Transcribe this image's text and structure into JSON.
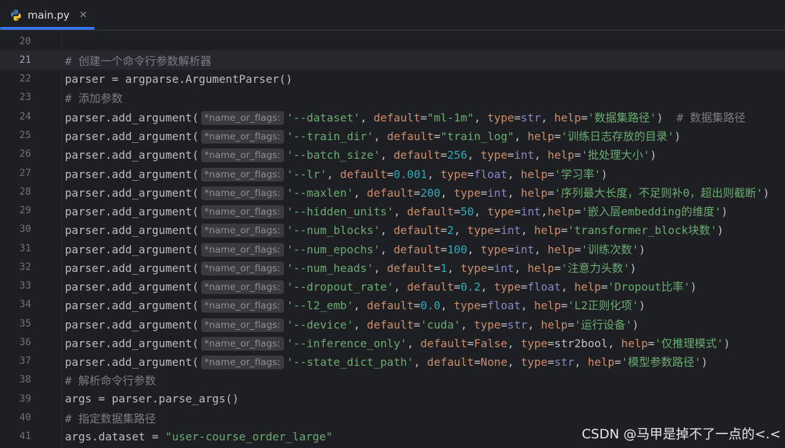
{
  "tab": {
    "filename": "main.py"
  },
  "current_line": 21,
  "lines": [
    {
      "n": "20",
      "segs": []
    },
    {
      "n": "21",
      "segs": [
        {
          "t": "# 创建一个命令行参数解析器",
          "c": "cmt"
        }
      ]
    },
    {
      "n": "22",
      "segs": [
        {
          "t": "parser = argparse.ArgumentParser()",
          "c": ""
        }
      ]
    },
    {
      "n": "23",
      "segs": [
        {
          "t": "# 添加参数",
          "c": "cmt"
        }
      ]
    },
    {
      "n": "24",
      "segs": [
        {
          "t": "parser.add_argument(",
          "c": ""
        },
        {
          "h": "*name_or_flags:"
        },
        {
          "t": "'--dataset'",
          "c": "str"
        },
        {
          "t": ", ",
          "c": ""
        },
        {
          "t": "default",
          "c": "kw"
        },
        {
          "t": "=",
          "c": ""
        },
        {
          "t": "\"ml-1m\"",
          "c": "str"
        },
        {
          "t": ", ",
          "c": ""
        },
        {
          "t": "type",
          "c": "kw"
        },
        {
          "t": "=",
          "c": ""
        },
        {
          "t": "str",
          "c": "builtin"
        },
        {
          "t": ", ",
          "c": ""
        },
        {
          "t": "help",
          "c": "kw"
        },
        {
          "t": "=",
          "c": ""
        },
        {
          "t": "'数据集路径'",
          "c": "str"
        },
        {
          "t": ")  ",
          "c": ""
        },
        {
          "t": "# 数据集路径",
          "c": "cmt"
        }
      ]
    },
    {
      "n": "25",
      "segs": [
        {
          "t": "parser.add_argument(",
          "c": ""
        },
        {
          "h": "*name_or_flags:"
        },
        {
          "t": "'--train_dir'",
          "c": "str"
        },
        {
          "t": ", ",
          "c": ""
        },
        {
          "t": "default",
          "c": "kw"
        },
        {
          "t": "=",
          "c": ""
        },
        {
          "t": "\"train_log\"",
          "c": "str"
        },
        {
          "t": ", ",
          "c": ""
        },
        {
          "t": "help",
          "c": "kw"
        },
        {
          "t": "=",
          "c": ""
        },
        {
          "t": "'训练日志存放的目录'",
          "c": "str"
        },
        {
          "t": ")",
          "c": ""
        }
      ]
    },
    {
      "n": "26",
      "segs": [
        {
          "t": "parser.add_argument(",
          "c": ""
        },
        {
          "h": "*name_or_flags:"
        },
        {
          "t": "'--batch_size'",
          "c": "str"
        },
        {
          "t": ", ",
          "c": ""
        },
        {
          "t": "default",
          "c": "kw"
        },
        {
          "t": "=",
          "c": ""
        },
        {
          "t": "256",
          "c": "num"
        },
        {
          "t": ", ",
          "c": ""
        },
        {
          "t": "type",
          "c": "kw"
        },
        {
          "t": "=",
          "c": ""
        },
        {
          "t": "int",
          "c": "builtin"
        },
        {
          "t": ", ",
          "c": ""
        },
        {
          "t": "help",
          "c": "kw"
        },
        {
          "t": "=",
          "c": ""
        },
        {
          "t": "'批处理大小'",
          "c": "str"
        },
        {
          "t": ")",
          "c": ""
        }
      ]
    },
    {
      "n": "27",
      "segs": [
        {
          "t": "parser.add_argument(",
          "c": ""
        },
        {
          "h": "*name_or_flags:"
        },
        {
          "t": "'--lr'",
          "c": "str"
        },
        {
          "t": ", ",
          "c": ""
        },
        {
          "t": "default",
          "c": "kw"
        },
        {
          "t": "=",
          "c": ""
        },
        {
          "t": "0.001",
          "c": "num"
        },
        {
          "t": ", ",
          "c": ""
        },
        {
          "t": "type",
          "c": "kw"
        },
        {
          "t": "=",
          "c": ""
        },
        {
          "t": "float",
          "c": "builtin"
        },
        {
          "t": ", ",
          "c": ""
        },
        {
          "t": "help",
          "c": "kw"
        },
        {
          "t": "=",
          "c": ""
        },
        {
          "t": "'学习率'",
          "c": "str"
        },
        {
          "t": ")",
          "c": ""
        }
      ]
    },
    {
      "n": "28",
      "segs": [
        {
          "t": "parser.add_argument(",
          "c": ""
        },
        {
          "h": "*name_or_flags:"
        },
        {
          "t": "'--maxlen'",
          "c": "str"
        },
        {
          "t": ", ",
          "c": ""
        },
        {
          "t": "default",
          "c": "kw"
        },
        {
          "t": "=",
          "c": ""
        },
        {
          "t": "200",
          "c": "num"
        },
        {
          "t": ", ",
          "c": ""
        },
        {
          "t": "type",
          "c": "kw"
        },
        {
          "t": "=",
          "c": ""
        },
        {
          "t": "int",
          "c": "builtin"
        },
        {
          "t": ", ",
          "c": ""
        },
        {
          "t": "help",
          "c": "kw"
        },
        {
          "t": "=",
          "c": ""
        },
        {
          "t": "'序列最大长度，不足则补0，超出则截断'",
          "c": "str"
        },
        {
          "t": ")",
          "c": ""
        }
      ]
    },
    {
      "n": "29",
      "segs": [
        {
          "t": "parser.add_argument(",
          "c": ""
        },
        {
          "h": "*name_or_flags:"
        },
        {
          "t": "'--hidden_units'",
          "c": "str"
        },
        {
          "t": ", ",
          "c": ""
        },
        {
          "t": "default",
          "c": "kw"
        },
        {
          "t": "=",
          "c": ""
        },
        {
          "t": "50",
          "c": "num"
        },
        {
          "t": ", ",
          "c": ""
        },
        {
          "t": "type",
          "c": "kw"
        },
        {
          "t": "=",
          "c": ""
        },
        {
          "t": "int",
          "c": "builtin"
        },
        {
          "t": ",",
          "c": ""
        },
        {
          "t": "help",
          "c": "kw"
        },
        {
          "t": "=",
          "c": ""
        },
        {
          "t": "'嵌入层embedding的维度'",
          "c": "str"
        },
        {
          "t": ")",
          "c": ""
        }
      ]
    },
    {
      "n": "30",
      "segs": [
        {
          "t": "parser.add_argument(",
          "c": ""
        },
        {
          "h": "*name_or_flags:"
        },
        {
          "t": "'--num_blocks'",
          "c": "str"
        },
        {
          "t": ", ",
          "c": ""
        },
        {
          "t": "default",
          "c": "kw"
        },
        {
          "t": "=",
          "c": ""
        },
        {
          "t": "2",
          "c": "num"
        },
        {
          "t": ", ",
          "c": ""
        },
        {
          "t": "type",
          "c": "kw"
        },
        {
          "t": "=",
          "c": ""
        },
        {
          "t": "int",
          "c": "builtin"
        },
        {
          "t": ", ",
          "c": ""
        },
        {
          "t": "help",
          "c": "kw"
        },
        {
          "t": "=",
          "c": ""
        },
        {
          "t": "'transformer_block块数'",
          "c": "str"
        },
        {
          "t": ")",
          "c": ""
        }
      ]
    },
    {
      "n": "31",
      "segs": [
        {
          "t": "parser.add_argument(",
          "c": ""
        },
        {
          "h": "*name_or_flags:"
        },
        {
          "t": "'--num_epochs'",
          "c": "str"
        },
        {
          "t": ", ",
          "c": ""
        },
        {
          "t": "default",
          "c": "kw"
        },
        {
          "t": "=",
          "c": ""
        },
        {
          "t": "100",
          "c": "num"
        },
        {
          "t": ", ",
          "c": ""
        },
        {
          "t": "type",
          "c": "kw"
        },
        {
          "t": "=",
          "c": ""
        },
        {
          "t": "int",
          "c": "builtin"
        },
        {
          "t": ", ",
          "c": ""
        },
        {
          "t": "help",
          "c": "kw"
        },
        {
          "t": "=",
          "c": ""
        },
        {
          "t": "'训练次数'",
          "c": "str"
        },
        {
          "t": ")",
          "c": ""
        }
      ]
    },
    {
      "n": "32",
      "segs": [
        {
          "t": "parser.add_argument(",
          "c": ""
        },
        {
          "h": "*name_or_flags:"
        },
        {
          "t": "'--num_heads'",
          "c": "str"
        },
        {
          "t": ", ",
          "c": ""
        },
        {
          "t": "default",
          "c": "kw"
        },
        {
          "t": "=",
          "c": ""
        },
        {
          "t": "1",
          "c": "num"
        },
        {
          "t": ", ",
          "c": ""
        },
        {
          "t": "type",
          "c": "kw"
        },
        {
          "t": "=",
          "c": ""
        },
        {
          "t": "int",
          "c": "builtin"
        },
        {
          "t": ", ",
          "c": ""
        },
        {
          "t": "help",
          "c": "kw"
        },
        {
          "t": "=",
          "c": ""
        },
        {
          "t": "'注意力头数'",
          "c": "str"
        },
        {
          "t": ")",
          "c": ""
        }
      ]
    },
    {
      "n": "33",
      "segs": [
        {
          "t": "parser.add_argument(",
          "c": ""
        },
        {
          "h": "*name_or_flags:"
        },
        {
          "t": "'--dropout_rate'",
          "c": "str"
        },
        {
          "t": ", ",
          "c": ""
        },
        {
          "t": "default",
          "c": "kw"
        },
        {
          "t": "=",
          "c": ""
        },
        {
          "t": "0.2",
          "c": "num"
        },
        {
          "t": ", ",
          "c": ""
        },
        {
          "t": "type",
          "c": "kw"
        },
        {
          "t": "=",
          "c": ""
        },
        {
          "t": "float",
          "c": "builtin"
        },
        {
          "t": ", ",
          "c": ""
        },
        {
          "t": "help",
          "c": "kw"
        },
        {
          "t": "=",
          "c": ""
        },
        {
          "t": "'Dropout比率'",
          "c": "str"
        },
        {
          "t": ")",
          "c": ""
        }
      ]
    },
    {
      "n": "34",
      "segs": [
        {
          "t": "parser.add_argument(",
          "c": ""
        },
        {
          "h": "*name_or_flags:"
        },
        {
          "t": "'--l2_emb'",
          "c": "str"
        },
        {
          "t": ", ",
          "c": ""
        },
        {
          "t": "default",
          "c": "kw"
        },
        {
          "t": "=",
          "c": ""
        },
        {
          "t": "0.0",
          "c": "num"
        },
        {
          "t": ", ",
          "c": ""
        },
        {
          "t": "type",
          "c": "kw"
        },
        {
          "t": "=",
          "c": ""
        },
        {
          "t": "float",
          "c": "builtin"
        },
        {
          "t": ", ",
          "c": ""
        },
        {
          "t": "help",
          "c": "kw"
        },
        {
          "t": "=",
          "c": ""
        },
        {
          "t": "'L2正则化项'",
          "c": "str"
        },
        {
          "t": ")",
          "c": ""
        }
      ]
    },
    {
      "n": "35",
      "segs": [
        {
          "t": "parser.add_argument(",
          "c": ""
        },
        {
          "h": "*name_or_flags:"
        },
        {
          "t": "'--device'",
          "c": "str"
        },
        {
          "t": ", ",
          "c": ""
        },
        {
          "t": "default",
          "c": "kw"
        },
        {
          "t": "=",
          "c": ""
        },
        {
          "t": "'cuda'",
          "c": "str"
        },
        {
          "t": ", ",
          "c": ""
        },
        {
          "t": "type",
          "c": "kw"
        },
        {
          "t": "=",
          "c": ""
        },
        {
          "t": "str",
          "c": "builtin"
        },
        {
          "t": ", ",
          "c": ""
        },
        {
          "t": "help",
          "c": "kw"
        },
        {
          "t": "=",
          "c": ""
        },
        {
          "t": "'运行设备'",
          "c": "str"
        },
        {
          "t": ")",
          "c": ""
        }
      ]
    },
    {
      "n": "36",
      "segs": [
        {
          "t": "parser.add_argument(",
          "c": ""
        },
        {
          "h": "*name_or_flags:"
        },
        {
          "t": "'--inference_only'",
          "c": "str"
        },
        {
          "t": ", ",
          "c": ""
        },
        {
          "t": "default",
          "c": "kw"
        },
        {
          "t": "=",
          "c": ""
        },
        {
          "t": "False",
          "c": "kw"
        },
        {
          "t": ", ",
          "c": ""
        },
        {
          "t": "type",
          "c": "kw"
        },
        {
          "t": "=",
          "c": ""
        },
        {
          "t": "str2bool",
          "c": ""
        },
        {
          "t": ", ",
          "c": ""
        },
        {
          "t": "help",
          "c": "kw"
        },
        {
          "t": "=",
          "c": ""
        },
        {
          "t": "'仅推理模式'",
          "c": "str"
        },
        {
          "t": ")",
          "c": ""
        }
      ]
    },
    {
      "n": "37",
      "segs": [
        {
          "t": "parser.add_argument(",
          "c": ""
        },
        {
          "h": "*name_or_flags:"
        },
        {
          "t": "'--state_dict_path'",
          "c": "str"
        },
        {
          "t": ", ",
          "c": ""
        },
        {
          "t": "default",
          "c": "kw"
        },
        {
          "t": "=",
          "c": ""
        },
        {
          "t": "None",
          "c": "kw"
        },
        {
          "t": ", ",
          "c": ""
        },
        {
          "t": "type",
          "c": "kw"
        },
        {
          "t": "=",
          "c": ""
        },
        {
          "t": "str",
          "c": "builtin"
        },
        {
          "t": ", ",
          "c": ""
        },
        {
          "t": "help",
          "c": "kw"
        },
        {
          "t": "=",
          "c": ""
        },
        {
          "t": "'模型参数路径'",
          "c": "str"
        },
        {
          "t": ")",
          "c": ""
        }
      ]
    },
    {
      "n": "38",
      "segs": [
        {
          "t": "# 解析命令行参数",
          "c": "cmt"
        }
      ]
    },
    {
      "n": "39",
      "segs": [
        {
          "t": "args = parser.parse_args()",
          "c": ""
        }
      ]
    },
    {
      "n": "40",
      "segs": [
        {
          "t": "# 指定数据集路径",
          "c": "cmt"
        }
      ]
    },
    {
      "n": "41",
      "segs": [
        {
          "t": "args.dataset = ",
          "c": ""
        },
        {
          "t": "\"user-course_order_large\"",
          "c": "str"
        }
      ]
    }
  ],
  "watermark": "CSDN @马甲是掉不了一点的<.<"
}
